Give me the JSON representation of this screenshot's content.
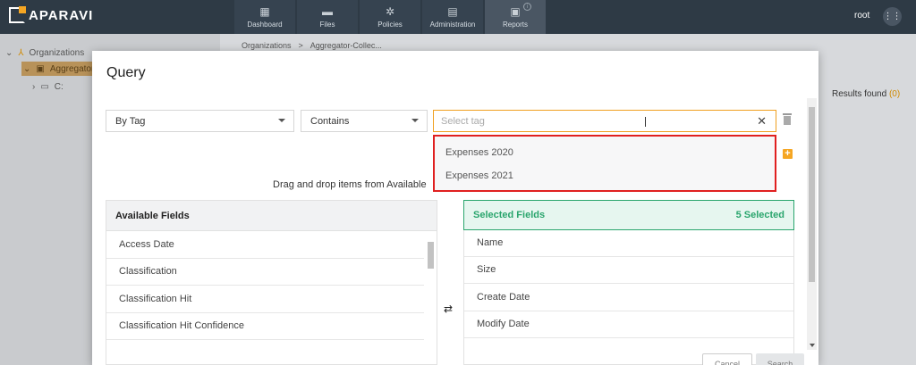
{
  "topbar": {
    "brand": "APARAVI",
    "nav": [
      {
        "label": "Dashboard",
        "icon": "dashboard-icon",
        "glyph": "▦"
      },
      {
        "label": "Files",
        "icon": "files-icon",
        "glyph": "▬"
      },
      {
        "label": "Policies",
        "icon": "gear-icon",
        "glyph": "✲"
      },
      {
        "label": "Administration",
        "icon": "admin-icon",
        "glyph": "▤"
      },
      {
        "label": "Reports",
        "icon": "clipboard-icon",
        "glyph": "▣"
      }
    ],
    "active_nav": "Reports",
    "user": "root"
  },
  "tree": {
    "root": "Organizations",
    "selected": "Aggregator-",
    "child": "C:"
  },
  "breadcrumb": [
    "Organizations",
    ">",
    "Aggregator-Collec..."
  ],
  "results": {
    "label": "Results found",
    "count": "(0)"
  },
  "modal": {
    "title": "Query",
    "filter_type": "By Tag",
    "operator": "Contains",
    "tag_placeholder": "Select tag",
    "tag_options": [
      "Expenses 2020",
      "Expenses 2021"
    ],
    "drag_hint": "Drag and drop items from Available",
    "available": {
      "title": "Available Fields",
      "fields": [
        "Access Date",
        "Classification",
        "Classification Hit",
        "Classification Hit Confidence"
      ]
    },
    "selected": {
      "title": "Selected Fields",
      "count_label": "5 Selected",
      "fields": [
        "Name",
        "Size",
        "Create Date",
        "Modify Date"
      ]
    },
    "buttons": {
      "cancel": "Cancel",
      "search": "Search"
    }
  },
  "colors": {
    "nav_bg": "#2e3a45",
    "accent": "#f5a623",
    "highlight_border": "#e02020",
    "selected_green": "#2aa56d"
  }
}
